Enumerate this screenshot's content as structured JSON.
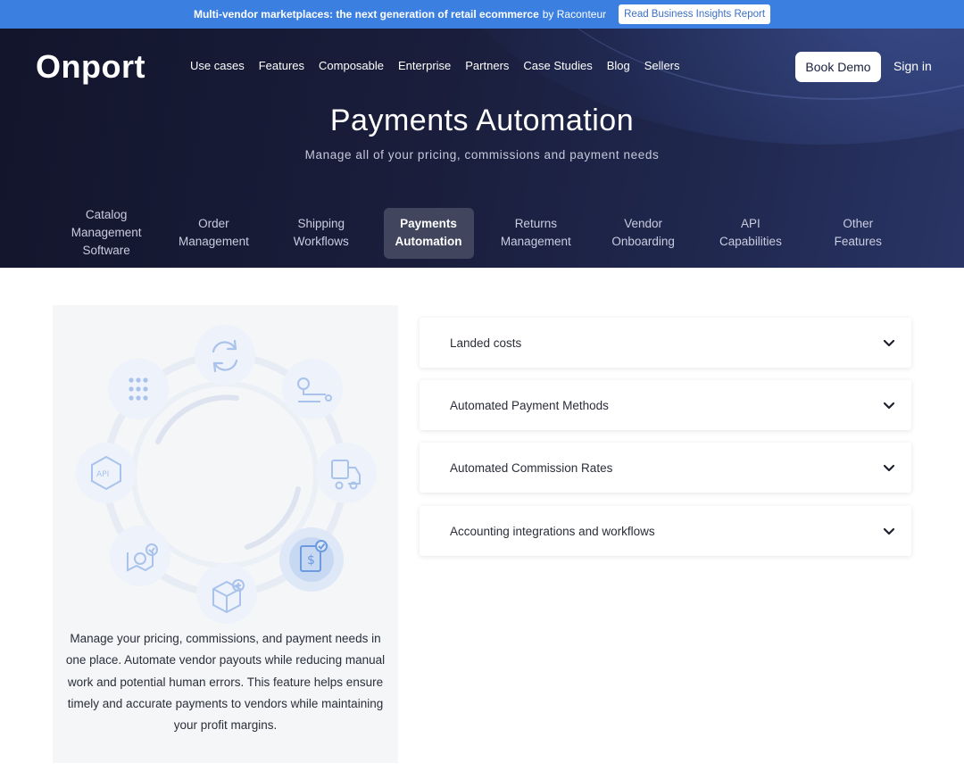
{
  "banner": {
    "lead": "Multi-vendor marketplaces: the next generation of retail ecommerce",
    "by": "by Raconteur",
    "cta": "Read Business Insights Report"
  },
  "header": {
    "logo": "Onport",
    "nav": [
      "Use cases",
      "Features",
      "Composable",
      "Enterprise",
      "Partners",
      "Case Studies",
      "Blog",
      "Sellers"
    ],
    "book_demo": "Book Demo",
    "sign_in": "Sign in"
  },
  "hero": {
    "title": "Payments Automation",
    "subtitle": "Manage all of your pricing, commissions and payment needs"
  },
  "feature_tabs": [
    {
      "line1": "Catalog",
      "line2": "Management",
      "line3": "Software",
      "active": false
    },
    {
      "line1": "Order",
      "line2": "Management",
      "line3": "",
      "active": false
    },
    {
      "line1": "Shipping",
      "line2": "Workflows",
      "line3": "",
      "active": false
    },
    {
      "line1": "Payments",
      "line2": "Automation",
      "line3": "",
      "active": true
    },
    {
      "line1": "Returns",
      "line2": "Management",
      "line3": "",
      "active": false
    },
    {
      "line1": "Vendor",
      "line2": "Onboarding",
      "line3": "",
      "active": false
    },
    {
      "line1": "API",
      "line2": "Capabilities",
      "line3": "",
      "active": false
    },
    {
      "line1": "Other",
      "line2": "Features",
      "line3": "",
      "active": false
    }
  ],
  "panel": {
    "icons": [
      "refresh-icon",
      "route-icon",
      "delivery-truck-icon",
      "invoice-dollar-icon",
      "box-add-icon",
      "map-check-icon",
      "api-icon",
      "grid-dots-icon"
    ],
    "api_label": "API",
    "description": "Manage your pricing, commissions, and payment needs in one place. Automate vendor payouts while reducing manual work and potential human errors. This feature helps ensure timely and accurate payments to vendors while maintaining your profit margins."
  },
  "accordion": [
    {
      "label": "Landed costs"
    },
    {
      "label": "Automated Payment Methods"
    },
    {
      "label": "Automated Commission Rates"
    },
    {
      "label": "Accounting integrations and workflows"
    }
  ],
  "colors": {
    "banner": "#3b7fe0",
    "hero_dark": "#12152b",
    "active_tab": "#41465e",
    "icon_blue": "#8fb1e6"
  }
}
